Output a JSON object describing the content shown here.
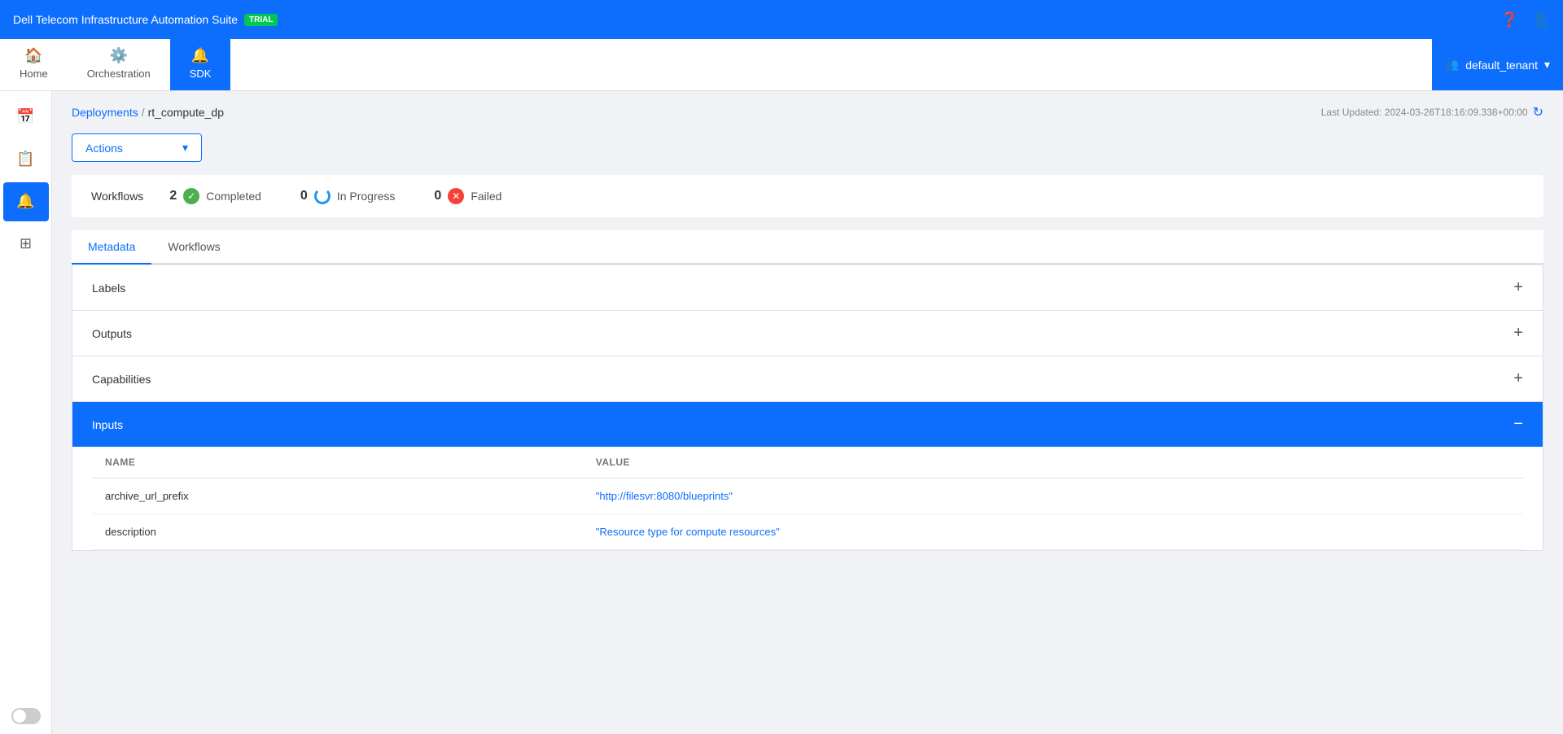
{
  "app": {
    "title": "Dell Telecom Infrastructure Automation Suite",
    "badge": "TRIAL"
  },
  "topbar": {
    "help_icon": "❓",
    "user_icon": "👤"
  },
  "nav": {
    "tabs": [
      {
        "id": "home",
        "label": "Home",
        "icon": "🏠",
        "active": false
      },
      {
        "id": "orchestration",
        "label": "Orchestration",
        "icon": "⚙️",
        "active": false
      },
      {
        "id": "sdk",
        "label": "SDK",
        "icon": "🔔",
        "active": true
      }
    ],
    "tenant": {
      "label": "default_tenant",
      "icon": "👥"
    }
  },
  "sidebar": {
    "items": [
      {
        "id": "calendar",
        "icon": "📅",
        "active": false
      },
      {
        "id": "list",
        "icon": "📋",
        "active": false
      },
      {
        "id": "sdk",
        "icon": "🔔",
        "active": true
      },
      {
        "id": "grid",
        "icon": "⊞",
        "active": false
      }
    ]
  },
  "breadcrumb": {
    "link": "Deployments",
    "separator": "/",
    "current": "rt_compute_dp"
  },
  "last_updated": {
    "label": "Last Updated: 2024-03-26T18:16:09.338+00:00"
  },
  "actions": {
    "label": "Actions"
  },
  "workflows": {
    "title": "Workflows",
    "completed_count": "2",
    "completed_label": "Completed",
    "in_progress_count": "0",
    "in_progress_label": "In Progress",
    "failed_count": "0",
    "failed_label": "Failed"
  },
  "tabs": {
    "items": [
      {
        "id": "metadata",
        "label": "Metadata",
        "active": true
      },
      {
        "id": "workflows",
        "label": "Workflows",
        "active": false
      }
    ]
  },
  "sections": {
    "labels": {
      "title": "Labels",
      "expanded": false
    },
    "outputs": {
      "title": "Outputs",
      "expanded": false
    },
    "capabilities": {
      "title": "Capabilities",
      "expanded": false
    },
    "inputs": {
      "title": "Inputs",
      "expanded": true,
      "table": {
        "col_name": "NAME",
        "col_value": "VALUE",
        "rows": [
          {
            "name": "archive_url_prefix",
            "value": "\"http://filesvr:8080/blueprints\""
          },
          {
            "name": "description",
            "value": "\"Resource type for compute resources\""
          }
        ]
      }
    }
  },
  "toggle": {
    "enabled": false
  }
}
